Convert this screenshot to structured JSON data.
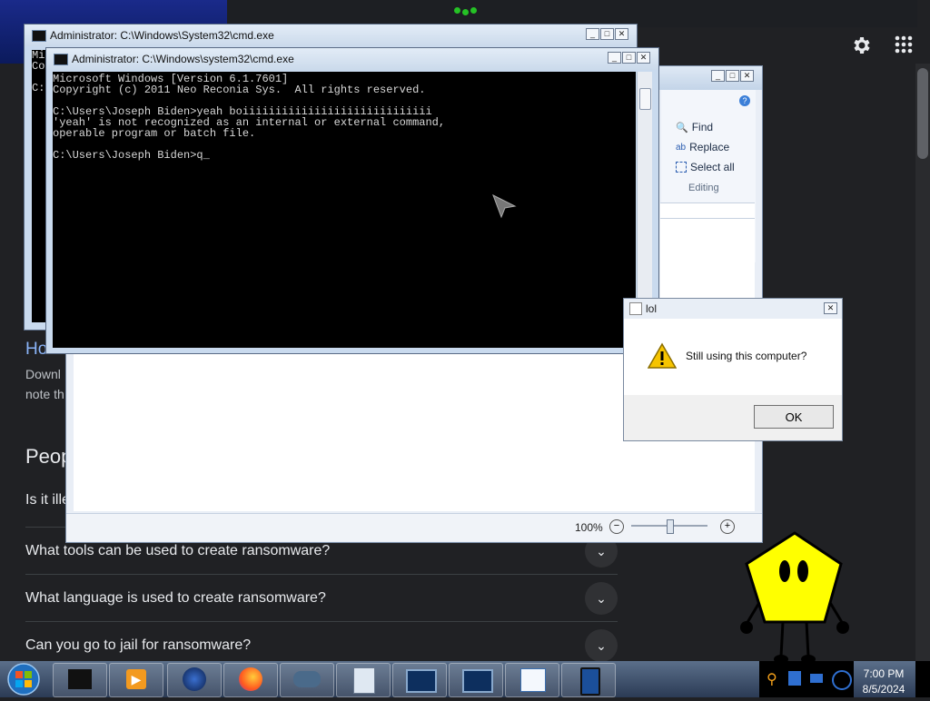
{
  "browser": {
    "heading_partial": "Ho",
    "text_line1_partial": "Downl",
    "text_line2_partial": "note th",
    "section_partial": "Peop",
    "question_partial": "Is it ille",
    "paa": [
      {
        "question": "What tools can be used to create ransomware?"
      },
      {
        "question": "What language is used to create ransomware?"
      },
      {
        "question": "Can you go to jail for ransomware?"
      }
    ],
    "icons": {
      "settings": "gear-icon",
      "apps": "apps-grid-icon",
      "chevron": "chevron-down-icon"
    }
  },
  "cmd_back": {
    "title": "Administrator: C:\\Windows\\System32\\cmd.exe",
    "visible_partial": "Mi\nCo\n\nC:"
  },
  "cmd_front": {
    "title": "Administrator: C:\\Windows\\system32\\cmd.exe",
    "console": "Microsoft Windows [Version 6.1.7601]\nCopyright (c) 2011 Neo Reconia Sys.  All rights reserved.\n\nC:\\Users\\Joseph Biden>yeah boiiiiiiiiiiiiiiiiiiiiiiiiiiiii\n'yeah' is not recognized as an internal or external command,\noperable program or batch file.\n\nC:\\Users\\Joseph Biden>q_"
  },
  "wordpad": {
    "ribbon": {
      "find": "Find",
      "replace": "Replace",
      "select_all": "Select all",
      "group": "Editing"
    },
    "zoom": "100%"
  },
  "dialog": {
    "title": "lol",
    "message": "Still using this computer?",
    "ok": "OK"
  },
  "taskbar": {
    "time": "7:00 PM",
    "date": "8/5/2024"
  },
  "colors": {
    "browser_bg": "#202124",
    "console_bg": "#000000",
    "character_yellow": "#ffff00"
  }
}
